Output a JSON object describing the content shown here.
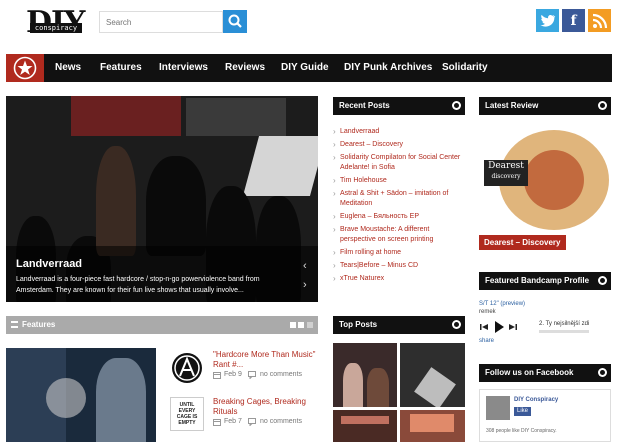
{
  "logo": {
    "main": "DIY",
    "sub": "conspiracy"
  },
  "search": {
    "placeholder": "Search"
  },
  "social": {
    "twitter": "twitter-icon",
    "facebook": "f",
    "rss": "rss-icon"
  },
  "nav": {
    "items": [
      "News",
      "Features",
      "Interviews",
      "Reviews",
      "DIY Guide",
      "DIY Punk Archives",
      "Solidarity"
    ]
  },
  "hero": {
    "title": "Landverraad",
    "excerpt": "Landverraad is a four-piece fast hardcore / stop-n-go powerviolence band from Amsterdam. They are known for their fun live shows that usually involve..."
  },
  "features": {
    "heading": "Features",
    "posts": [
      {
        "title": "\"Hardcore More Than Music\" Rant #...",
        "date": "Feb 9",
        "comments": "no comments"
      },
      {
        "title": "Breaking Cages, Breaking Rituals",
        "date": "Feb 7",
        "comments": "no comments",
        "thumb_text": "UNTIL EVERY CAGE IS EMPTY"
      }
    ]
  },
  "recent_posts": {
    "heading": "Recent Posts",
    "items": [
      "Landverraad",
      "Dearest – Discovery",
      "Solidarity Compilaton for Social Center Adelante! in Sofia",
      "Tim Holehouse",
      "Astral & Shit + Sädon – imitation of Meditation",
      "Euglena – Бяльность EP",
      "Brave Moustache: A different perspective on screen printing",
      "Film rolling at home",
      "Tears|Before – Minus CD",
      "xTrue Naturex"
    ]
  },
  "top_posts": {
    "heading": "Top Posts"
  },
  "latest_review": {
    "heading": "Latest Review",
    "title": "Dearest – Discovery",
    "cover_band": "Dearest",
    "cover_title": "discovery"
  },
  "bandcamp": {
    "heading": "Featured Bandcamp Profile",
    "track_line": "S/T 12\" (preview)",
    "artist": "remek",
    "now_playing": "2. Ty nejsilnější zdi",
    "share": "share"
  },
  "facebook": {
    "heading": "Follow us on Facebook",
    "page_name": "DIY Conspiracy",
    "like": "Like",
    "count_text": "308 people like DIY Conspiracy."
  },
  "colors": {
    "accent": "#b02a1e",
    "nav_bg": "#111111",
    "search_btn": "#2a8fd6"
  }
}
